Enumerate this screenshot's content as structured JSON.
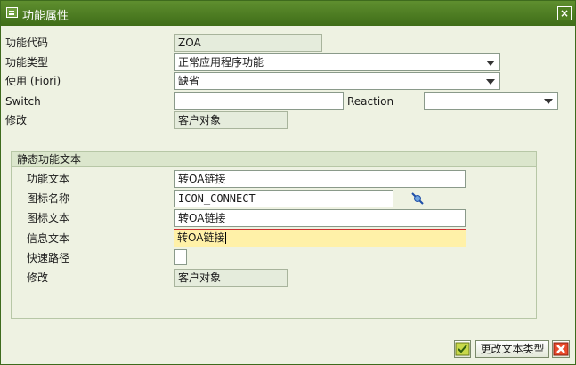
{
  "window": {
    "title": "功能属性",
    "close_label": "×"
  },
  "form": {
    "func_code": {
      "label": "功能代码",
      "value": "ZOA"
    },
    "func_type": {
      "label": "功能类型",
      "value": "正常应用程序功能"
    },
    "use_fiori": {
      "label": "使用 (Fiori)",
      "value": "缺省"
    },
    "switch": {
      "label": "Switch",
      "value": ""
    },
    "reaction": {
      "label": "Reaction",
      "value": ""
    },
    "modify": {
      "label": "修改",
      "value": "客户对象"
    }
  },
  "static_group": {
    "title": "静态功能文本",
    "func_text": {
      "label": "功能文本",
      "value": "转OA链接"
    },
    "icon_name": {
      "label": "图标名称",
      "value": "ICON_CONNECT"
    },
    "icon_text": {
      "label": "图标文本",
      "value": "转OA链接"
    },
    "info_text": {
      "label": "信息文本",
      "value": "转OA链接"
    },
    "shortcut": {
      "label": "快速路径",
      "value": ""
    },
    "modify": {
      "label": "修改",
      "value": "客户对象"
    }
  },
  "footer": {
    "change_text_type_label": "更改文本类型"
  },
  "icons": {
    "title": "window-icon",
    "connect": "connect-icon",
    "confirm": "checkmark-icon",
    "cancel": "cancel-x-icon"
  },
  "colors": {
    "titlebar": "#4f7f22",
    "background": "#eef2e2",
    "focus_field": "#fff1a8",
    "focus_border": "#cc3333"
  }
}
